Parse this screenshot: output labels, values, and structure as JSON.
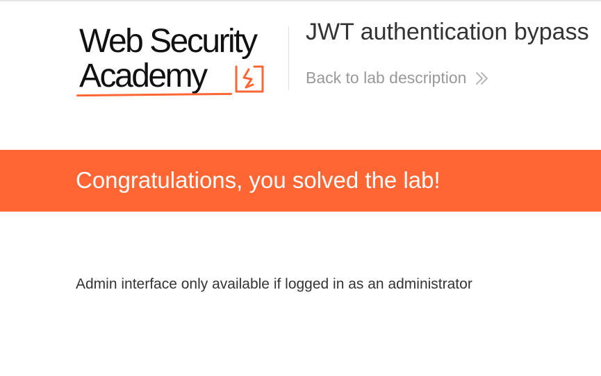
{
  "header": {
    "logo": {
      "line1": "Web Security",
      "line2": "Academy",
      "icon": "lightning-bolt-icon",
      "accent_color": "#ff6633"
    },
    "lab_title": "JWT authentication bypass",
    "back_link": {
      "label": "Back to lab description",
      "icon": "double-chevron-right-icon"
    }
  },
  "banner": {
    "text": "Congratulations, you solved the lab!",
    "background": "#ff6633"
  },
  "main": {
    "message": "Admin interface only available if logged in as an administrator"
  }
}
